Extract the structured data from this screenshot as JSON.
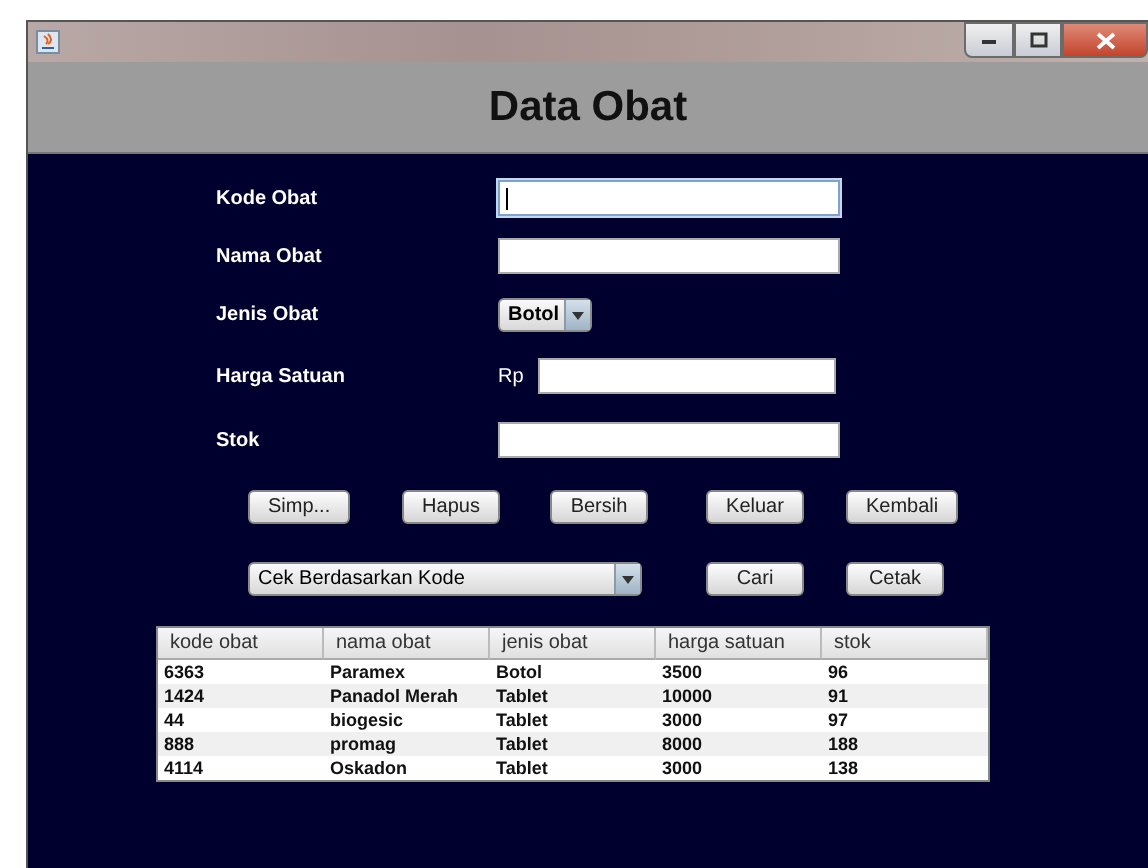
{
  "window": {
    "heading": "Data Obat"
  },
  "form": {
    "fields": [
      {
        "kind": "text",
        "label": "Kode Obat",
        "focused": true
      },
      {
        "kind": "text",
        "label": "Nama Obat",
        "focused": false
      },
      {
        "kind": "select",
        "label": "Jenis Obat",
        "value": "Botol"
      },
      {
        "kind": "currency",
        "label": "Harga Satuan",
        "prefix": "Rp",
        "focused": false
      },
      {
        "kind": "text",
        "label": "Stok",
        "focused": false
      }
    ]
  },
  "buttons": [
    "Simp...",
    "Hapus",
    "Bersih",
    "Keluar",
    "Kembali"
  ],
  "search": {
    "mode": "Cek Berdasarkan Kode",
    "buttons": [
      "Cari",
      "Cetak"
    ]
  },
  "table": {
    "columns": [
      "kode obat",
      "nama obat",
      "jenis obat",
      "harga satuan",
      "stok"
    ],
    "rows": [
      [
        "6363",
        "Paramex",
        "Botol",
        "3500",
        "96"
      ],
      [
        "1424",
        "Panadol Merah",
        "Tablet",
        "10000",
        "91"
      ],
      [
        "44",
        "biogesic",
        "Tablet",
        "3000",
        "97"
      ],
      [
        "888",
        "promag",
        "Tablet",
        "8000",
        "188"
      ],
      [
        "4114",
        "Oskadon",
        "Tablet",
        "3000",
        "138"
      ]
    ]
  }
}
